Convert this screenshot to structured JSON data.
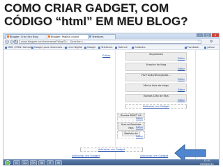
{
  "slide": {
    "title_line1": "COMO CRIAR GADGET, COM",
    "title_line2": "CÓDIGO “html” EM MEU BLOG?"
  },
  "browser": {
    "tabs": [
      {
        "label": "Blogger: Criar Seu Blog"
      },
      {
        "label": "Blogger: Página Layout"
      },
      {
        "label": "Telefones"
      }
    ],
    "window_buttons": {
      "minimize": "–",
      "maximize": "□",
      "close": "x"
    },
    "address": "www.blogger.com/rearrange?blogID=…&section=…",
    "bookmarks": [
      {
        "label": "MSN / MSN Hotmail"
      },
      {
        "label": "Google para desenvolv…"
      },
      {
        "label": "Livro Digital"
      },
      {
        "label": "Google"
      },
      {
        "label": "Telefones"
      },
      {
        "label": "Hotmail"
      },
      {
        "label": "Cadastro"
      },
      {
        "label": "Facebook"
      },
      {
        "label": "yahoo"
      }
    ]
  },
  "page": {
    "left_edit": "Editar",
    "gadgets": [
      {
        "title": "Seguidores",
        "edit": "Editar"
      },
      {
        "title": "Arquivo do blog",
        "edit": "Editar"
      },
      {
        "title": "Faz+ação/divulgação…",
        "edit": "Editar"
      },
      {
        "title": "Minha lista de blogs",
        "edit": "Editar"
      },
      {
        "title": "Bordas Cléa de Faja",
        "edit": "Editar"
      }
    ],
    "add_gadget_label": "Adicionar um Gadget",
    "small_gadgets": [
      {
        "title": "Bordas DMST Sit",
        "edit": "Editar"
      },
      {
        "title": "Acervo Bordado Faja",
        "edit": "Editar"
      },
      {
        "title": "Rabisks de",
        "edit": "Editar"
      }
    ],
    "bottom_add_center": "Adicionar um Gadget",
    "bottom_add_left": "Adicionar um Gadget",
    "bottom_add_right": "Adicionar um Gadget"
  },
  "taskbar": {
    "apps": [
      "IE",
      "Ex",
      "Ch",
      "W",
      "P",
      "M"
    ],
    "clock_time": "13:41",
    "clock_date": "09/03/2012"
  },
  "colors": {
    "arrow_fill": "#4f86cf",
    "arrow_stroke": "#2d5c99",
    "title_color": "#1a1a1a"
  }
}
